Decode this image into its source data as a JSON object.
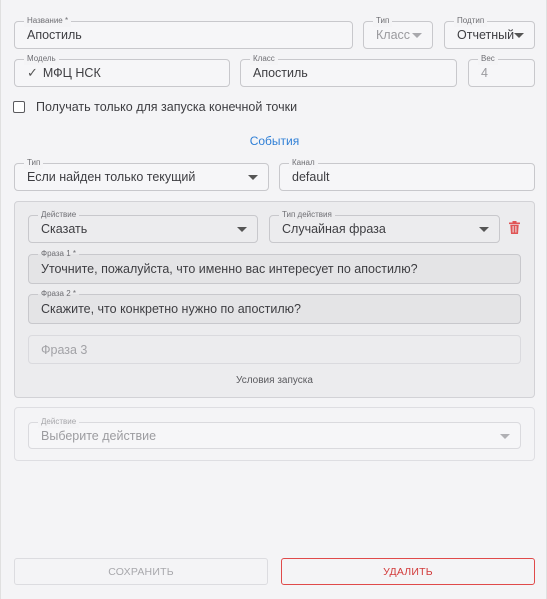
{
  "form": {
    "name": {
      "label": "Название *",
      "value": "Апостиль"
    },
    "type": {
      "label": "Тип",
      "value": "Класс"
    },
    "subtype": {
      "label": "Подтип",
      "value": "Отчетный"
    },
    "model": {
      "label": "Модель",
      "value": "МФЦ НСК"
    },
    "class": {
      "label": "Класс",
      "value": "Апостиль"
    },
    "weight": {
      "label": "Вес",
      "value": "4"
    },
    "endpoint_only": {
      "label": "Получать только для запуска конечной точки",
      "checked": false
    }
  },
  "events": {
    "title": "События",
    "type": {
      "label": "Тип",
      "value": "Если найден только текущий"
    },
    "channel": {
      "label": "Канал",
      "value": "default"
    },
    "action": {
      "action_field": {
        "label": "Действие",
        "value": "Сказать"
      },
      "action_type": {
        "label": "Тип действия",
        "value": "Случайная фраза"
      },
      "phrase1": {
        "label": "Фраза 1 *",
        "value": "Уточните, пожалуйста, что именно вас интересует по апостилю?"
      },
      "phrase2": {
        "label": "Фраза 2 *",
        "value": "Скажите, что конкретно нужно по апостилю?"
      },
      "phrase3": {
        "placeholder": "Фраза 3"
      },
      "conditions_link": "Условия запуска",
      "delete_icon": "trash-icon",
      "delete_color": "#e05555"
    },
    "new_action": {
      "label": "Действие",
      "placeholder": "Выберите действие"
    }
  },
  "footer": {
    "save_label": "СОХРАНИТЬ",
    "delete_label": "УДАЛИТЬ",
    "delete_color": "#d23a3a",
    "link_color": "#2f7fd6"
  }
}
